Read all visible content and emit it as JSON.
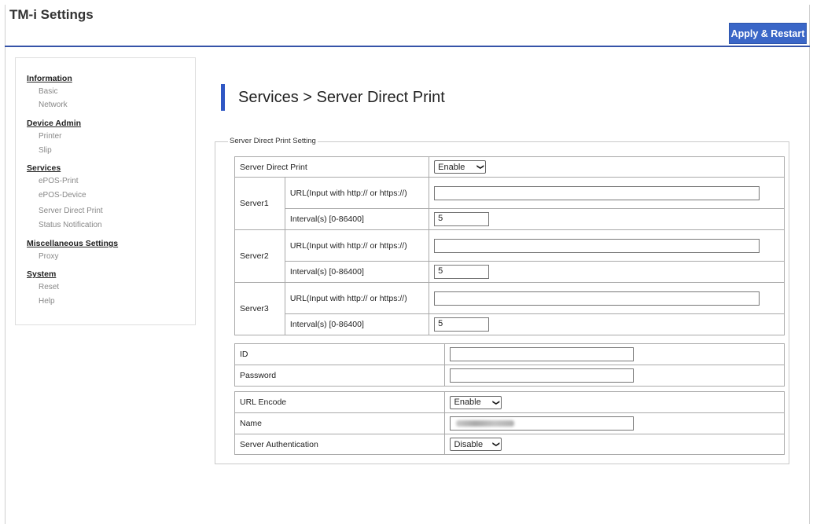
{
  "app": {
    "title": "TM-i Settings",
    "apply_label": "Apply & Restart"
  },
  "sidebar": {
    "groups": [
      {
        "title": "Information",
        "items": [
          "Basic",
          "Network"
        ]
      },
      {
        "title": "Device Admin",
        "items": [
          "Printer",
          "Slip"
        ]
      },
      {
        "title": "Services",
        "items": [
          "ePOS-Print",
          "ePOS-Device",
          "Server Direct Print",
          "Status Notification"
        ]
      },
      {
        "title": "Miscellaneous Settings",
        "items": [
          "Proxy"
        ]
      },
      {
        "title": "System",
        "items": [
          "Reset",
          "Help"
        ]
      }
    ]
  },
  "page": {
    "title": "Services > Server Direct Print",
    "fieldset_legend": "Server Direct Print Setting"
  },
  "sdp": {
    "label": "Server Direct Print",
    "value": "Enable",
    "url_label": "URL(Input with http:// or https://)",
    "interval_label": "Interval(s) [0-86400]",
    "servers": [
      {
        "name": "Server1",
        "url": "",
        "interval": "5"
      },
      {
        "name": "Server2",
        "url": "",
        "interval": "5"
      },
      {
        "name": "Server3",
        "url": "",
        "interval": "5"
      }
    ]
  },
  "auth": {
    "id_label": "ID",
    "id_value": "",
    "password_label": "Password",
    "password_value": ""
  },
  "misc": {
    "url_encode_label": "URL Encode",
    "url_encode_value": "Enable",
    "name_label": "Name",
    "server_auth_label": "Server Authentication",
    "server_auth_value": "Disable"
  }
}
